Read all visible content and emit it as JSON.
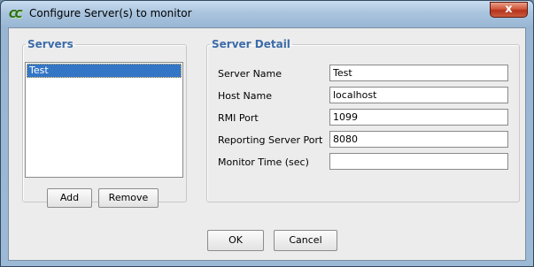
{
  "window": {
    "title": "Configure Server(s) to monitor",
    "app_icon_text": "CC",
    "close_glyph": "x"
  },
  "servers": {
    "legend": "Servers",
    "items": [
      "Test"
    ],
    "add_label": "Add",
    "remove_label": "Remove"
  },
  "detail": {
    "legend": "Server Detail",
    "fields": [
      {
        "label": "Server Name",
        "value": "Test"
      },
      {
        "label": "Host Name",
        "value": "localhost"
      },
      {
        "label": "RMI Port",
        "value": "1099"
      },
      {
        "label": "Reporting Server Port",
        "value": "8080"
      },
      {
        "label": "Monitor Time (sec)",
        "value": ""
      }
    ]
  },
  "footer": {
    "ok_label": "OK",
    "cancel_label": "Cancel"
  },
  "colors": {
    "legend": "#3c6ba8",
    "selection": "#3476c6",
    "close_button": "#c4442a"
  }
}
